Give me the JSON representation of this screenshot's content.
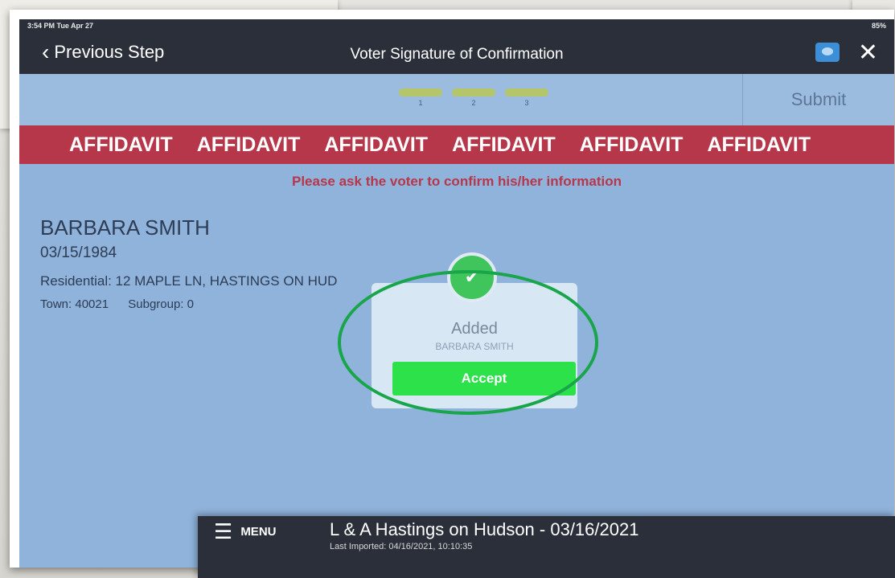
{
  "status": {
    "time": "3:54 PM  Tue Apr 27",
    "battery": "85%"
  },
  "nav": {
    "back_label": "Previous Step",
    "title": "Voter Signature of Confirmation"
  },
  "steps": [
    "1",
    "2",
    "3"
  ],
  "submit_label": "Submit",
  "banner": [
    "AFFIDAVIT",
    "AFFIDAVIT",
    "AFFIDAVIT",
    "AFFIDAVIT",
    "AFFIDAVIT",
    "AFFIDAVIT"
  ],
  "instruction": "Please ask the voter to confirm his/her information",
  "voter": {
    "name": "BARBARA SMITH",
    "dob": "03/15/1984",
    "residential": "Residential: 12 MAPLE LN, HASTINGS ON HUD",
    "town": "Town: 40021",
    "subgroup": "Subgroup: 0"
  },
  "modal": {
    "title": "Added",
    "subtitle": "BARBARA SMITH",
    "accept_label": "Accept"
  },
  "menubar": {
    "menu_label": "MENU",
    "title": "L & A Hastings on Hudson  - 03/16/2021",
    "subtitle": "Last Imported: 04/16/2021, 10:10:35"
  },
  "colors": {
    "banner": "#b7374a",
    "accept": "#2de14a",
    "highlight_circle": "#19a54a",
    "navbar": "#2a2f3a",
    "screen_bg": "#8fb3db"
  },
  "icons": [
    "chevron-left-icon",
    "chat-icon",
    "close-icon",
    "check-icon",
    "hamburger-menu-icon"
  ]
}
